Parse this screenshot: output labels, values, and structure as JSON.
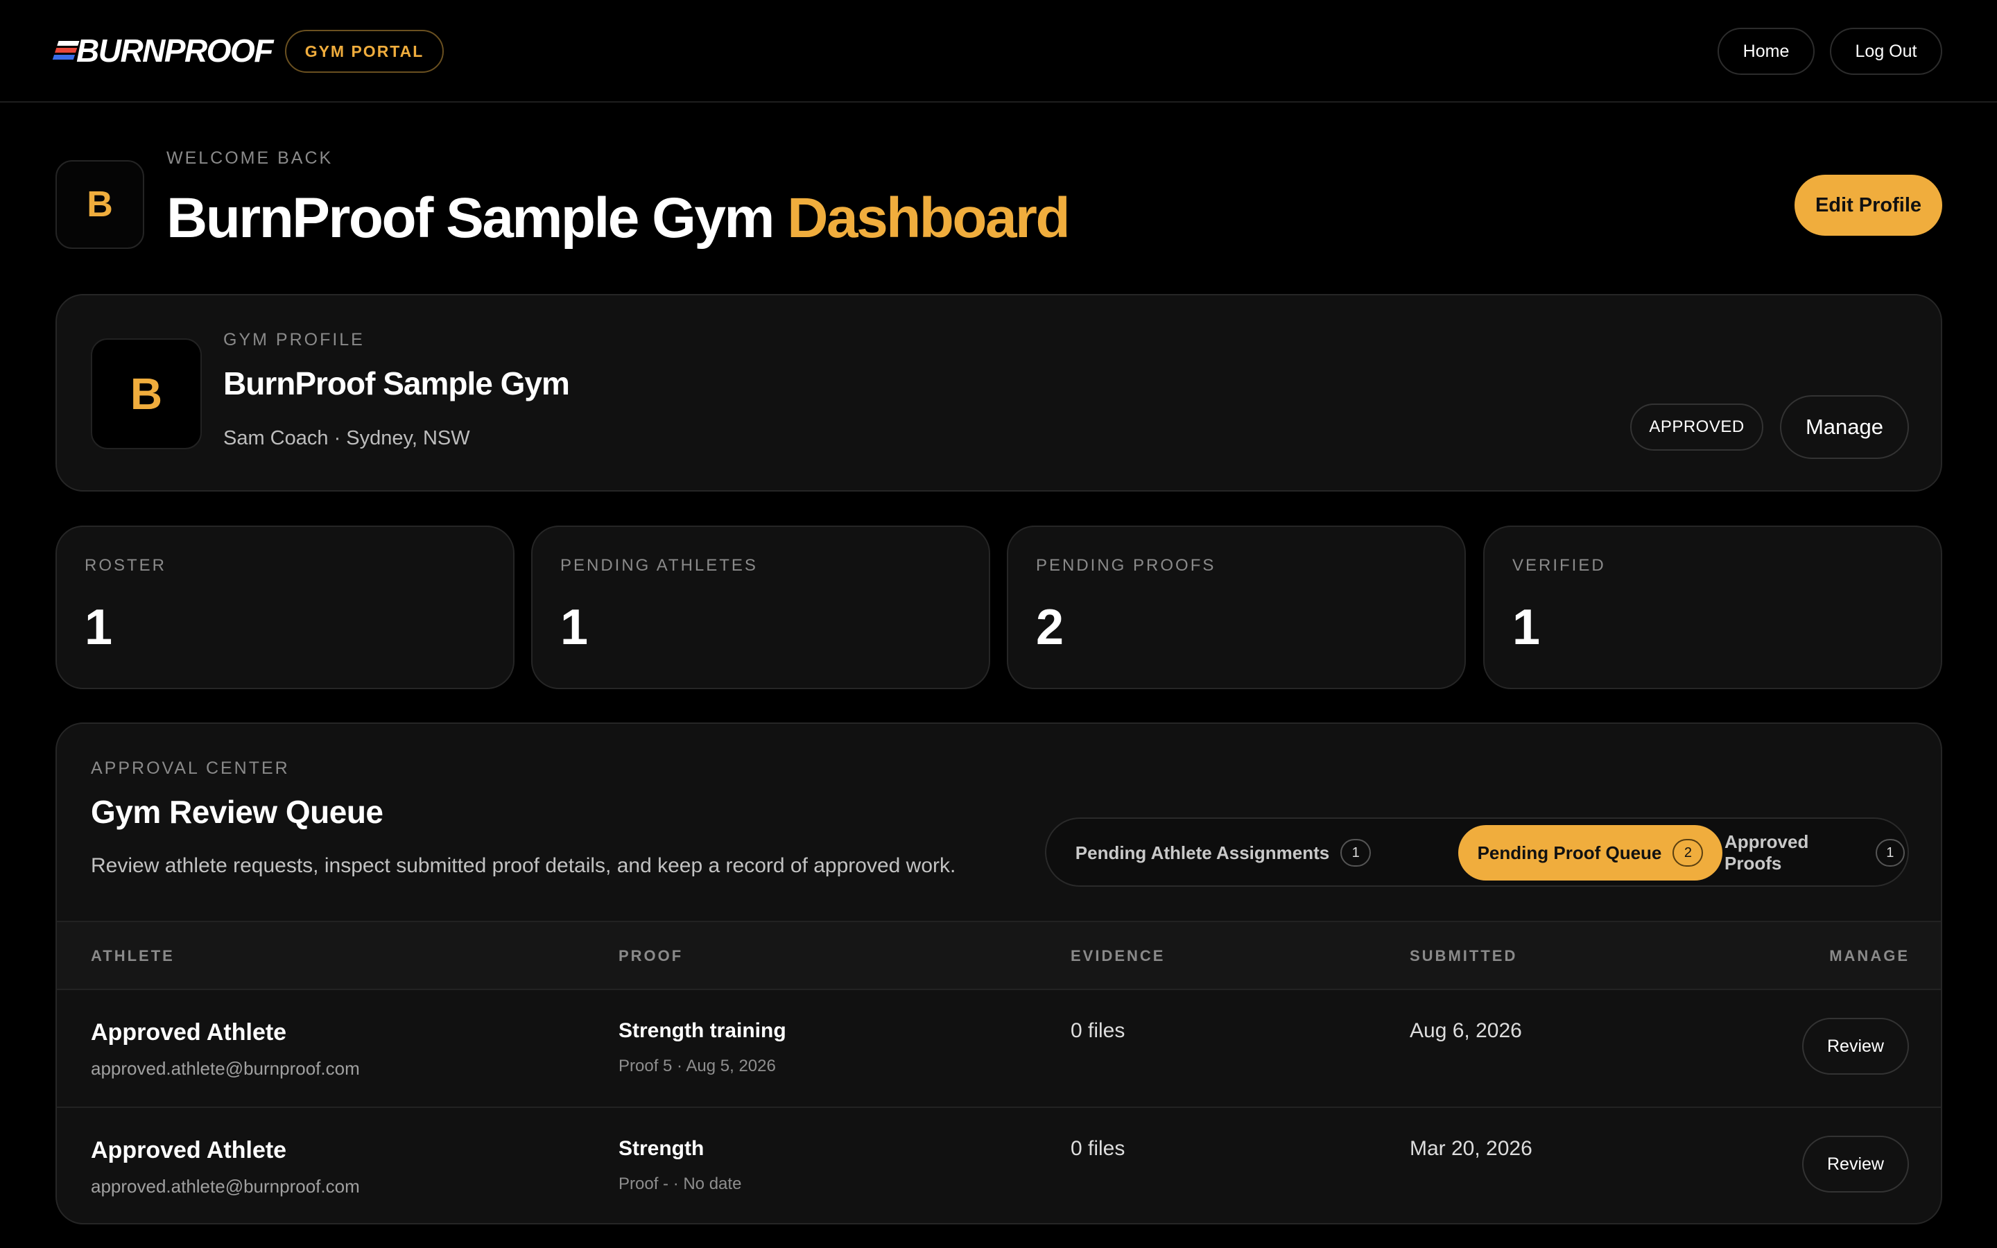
{
  "header": {
    "brand": "BURNPROOF",
    "portal_badge": "GYM PORTAL",
    "nav": {
      "home": "Home",
      "logout": "Log Out"
    }
  },
  "welcome": {
    "label": "WELCOME BACK",
    "avatar_initial": "B",
    "title": "BurnProof Sample Gym",
    "title_accent": "Dashboard",
    "edit_profile": "Edit Profile"
  },
  "profile": {
    "label": "GYM PROFILE",
    "avatar_initial": "B",
    "name": "BurnProof Sample Gym",
    "subtitle": "Sam Coach · Sydney, NSW",
    "status": "APPROVED",
    "manage": "Manage"
  },
  "stats": [
    {
      "label": "ROSTER",
      "value": "1"
    },
    {
      "label": "PENDING ATHLETES",
      "value": "1"
    },
    {
      "label": "PENDING PROOFS",
      "value": "2"
    },
    {
      "label": "VERIFIED",
      "value": "1"
    }
  ],
  "queue": {
    "label": "APPROVAL CENTER",
    "title": "Gym Review Queue",
    "description": "Review athlete requests, inspect submitted proof details, and keep a record of approved work.",
    "tabs": [
      {
        "label": "Pending Athlete Assignments",
        "count": "1",
        "active": false
      },
      {
        "label": "Pending Proof Queue",
        "count": "2",
        "active": true
      },
      {
        "label": "Approved Proofs",
        "count": "1",
        "active": false
      }
    ],
    "columns": {
      "athlete": "ATHLETE",
      "proof": "PROOF",
      "evidence": "EVIDENCE",
      "submitted": "SUBMITTED",
      "manage": "MANAGE"
    },
    "rows": [
      {
        "athlete": "Approved Athlete",
        "email": "approved.athlete@burnproof.com",
        "proof": "Strength training",
        "proof_meta": "Proof 5 · Aug 5, 2026",
        "evidence": "0 files",
        "submitted": "Aug 6, 2026",
        "action": "Review"
      },
      {
        "athlete": "Approved Athlete",
        "email": "approved.athlete@burnproof.com",
        "proof": "Strength",
        "proof_meta": "Proof - · No date",
        "evidence": "0 files",
        "submitted": "Mar 20, 2026",
        "action": "Review"
      }
    ]
  },
  "colors": {
    "accent": "#f0ad3d",
    "background": "#000000",
    "card": "#111111",
    "logo_stripes": [
      "#ffffff",
      "#e8473a",
      "#3a6de8"
    ]
  }
}
